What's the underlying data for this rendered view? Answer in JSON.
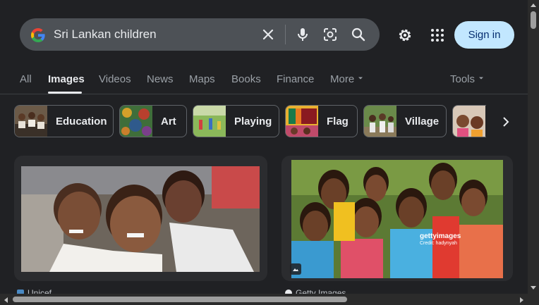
{
  "search": {
    "query": "Sri Lankan children"
  },
  "header": {
    "signin_label": "Sign in"
  },
  "tabs": [
    {
      "label": "All"
    },
    {
      "label": "Images"
    },
    {
      "label": "Videos"
    },
    {
      "label": "News"
    },
    {
      "label": "Maps"
    },
    {
      "label": "Books"
    },
    {
      "label": "Finance"
    },
    {
      "label": "More"
    }
  ],
  "tools_label": "Tools",
  "chips": [
    {
      "label": "Education"
    },
    {
      "label": "Art"
    },
    {
      "label": "Playing"
    },
    {
      "label": "Flag"
    },
    {
      "label": "Village"
    }
  ],
  "results": [
    {
      "source": "Unicef"
    },
    {
      "source": "Getty Images",
      "watermark": "gettyimages",
      "credit": "Credit: hadynyah"
    }
  ],
  "icons": [
    "google-logo",
    "clear-icon",
    "mic-icon",
    "lens-icon",
    "search-icon",
    "settings-icon",
    "apps-icon",
    "chevron-right-icon"
  ],
  "colors": {
    "accent": "#c2e7ff",
    "background": "#202124",
    "search_bg": "#4d5156"
  }
}
